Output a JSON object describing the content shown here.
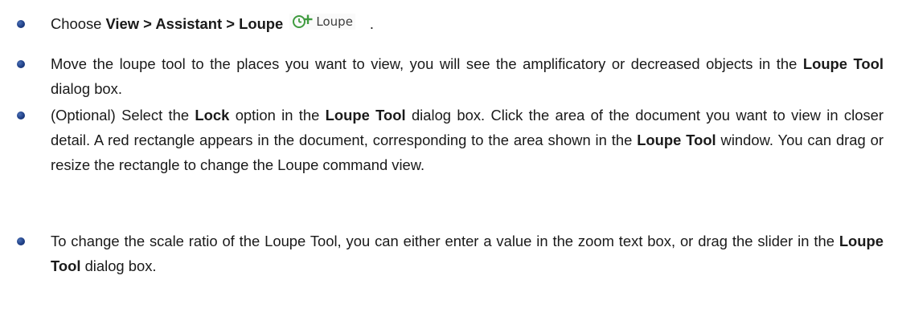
{
  "step1": {
    "prefix": "Choose ",
    "menu_path": "View > Assistant > Loupe",
    "button_label": "Loupe",
    "button_icon": "loupe-icon",
    "suffix": "."
  },
  "step2": {
    "text_a": "Move the loupe tool to the places you want to view, you will see the amplificatory or decreased objects in the ",
    "bold_a": "Loupe Tool",
    "text_b": " dialog box."
  },
  "step3": {
    "text_a": "(Optional) Select the ",
    "bold_a": "Lock",
    "text_b": " option in the ",
    "bold_b": "Loupe Tool",
    "text_c": " dialog box. Click the area of the document you want to view in closer detail. A red rectangle appears in the document, corresponding to the area shown in the ",
    "bold_c": "Loupe Tool",
    "text_d": " window. You can drag or resize the rectangle to change the Loupe command view."
  },
  "step4": {
    "text_a": "To change the scale ratio of the Loupe Tool, you can either enter a value in the zoom text box, or drag the slider in the ",
    "bold_a": "Loupe Tool",
    "text_b": " dialog box."
  },
  "colors": {
    "bullet": "#1f3f86",
    "icon_green": "#3f9b3f",
    "text": "#1a1a1a"
  }
}
